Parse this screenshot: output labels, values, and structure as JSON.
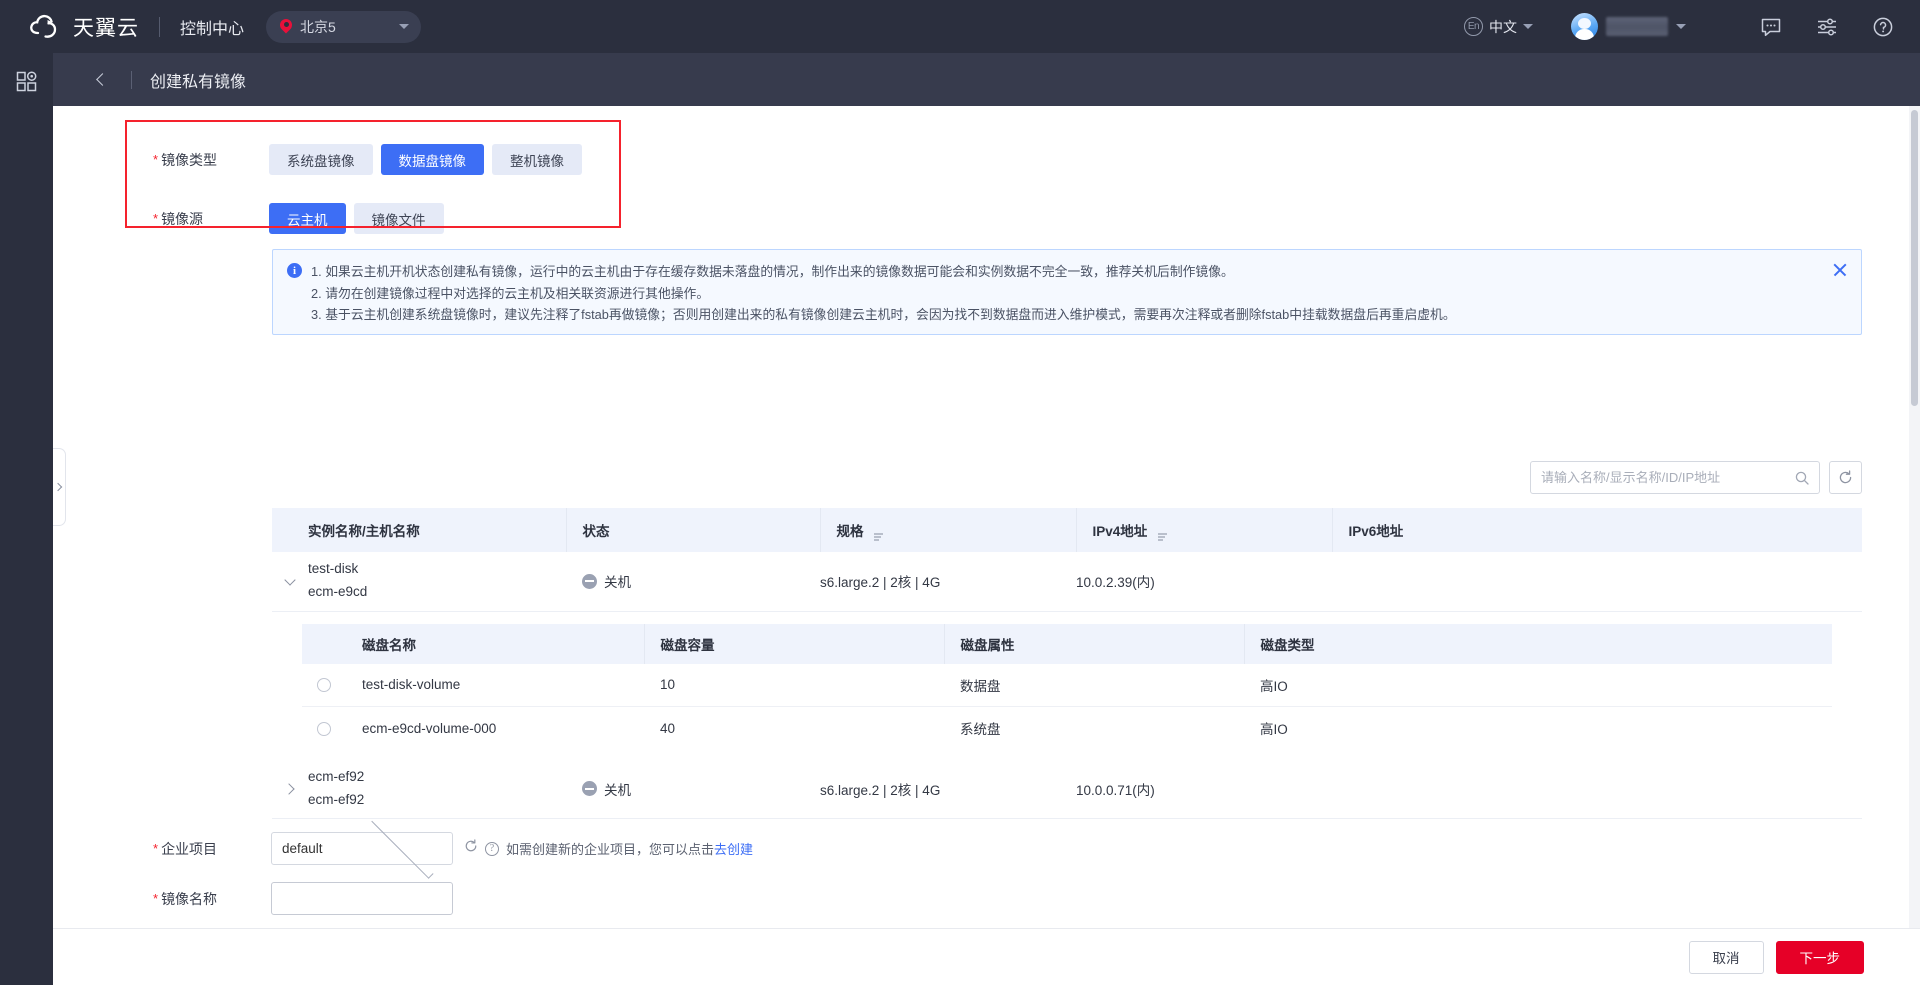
{
  "topbar": {
    "brand": "天翼云",
    "console_title": "控制中心",
    "region": "北京5",
    "lang_en": "En",
    "lang_label": "中文",
    "icons": {
      "pin": "location-pin-icon",
      "avatar": "avatar",
      "chat": "chat-icon",
      "settings": "sliders-icon",
      "help": "help-circle-icon"
    }
  },
  "subheader": {
    "title": "创建私有镜像",
    "back": "back-chevron-icon"
  },
  "form": {
    "image_type": {
      "label": "镜像类型",
      "required": true,
      "options": [
        "系统盘镜像",
        "数据盘镜像",
        "整机镜像"
      ],
      "selected": "数据盘镜像"
    },
    "image_source": {
      "label": "镜像源",
      "required": true,
      "options": [
        "云主机",
        "镜像文件"
      ],
      "selected": "云主机"
    },
    "enterprise_project": {
      "label": "企业项目",
      "required": true,
      "value": "default",
      "hint_prefix": "如需创建新的企业项目，您可以点击",
      "hint_link": "去创建"
    },
    "image_name": {
      "label": "镜像名称",
      "required": true,
      "value": "",
      "placeholder": ""
    }
  },
  "notice": {
    "lines": [
      "1. 如果云主机开机状态创建私有镜像，运行中的云主机由于存在缓存数据未落盘的情况，制作出来的镜像数据可能会和实例数据不完全一致，推荐关机后制作镜像。",
      "2. 请勿在创建镜像过程中对选择的云主机及相关联资源进行其他操作。",
      "3. 基于云主机创建系统盘镜像时，建议先注释了fstab再做镜像；否则用创建出来的私有镜像创建云主机时，会因为找不到数据盘而进入维护模式，需要再次注释或者删除fstab中挂载数据盘后再重启虚机。"
    ]
  },
  "search": {
    "placeholder": "请输入名称/显示名称/ID/IP地址",
    "value": ""
  },
  "instance_table": {
    "columns": [
      "实例名称/主机名称",
      "状态",
      "规格",
      "IPv4地址",
      "IPv6地址"
    ],
    "sortable": [
      "规格",
      "IPv4地址"
    ],
    "rows": [
      {
        "expanded": true,
        "name": "test-disk",
        "hostname": "ecm-e9cd",
        "status": "关机",
        "spec": "s6.large.2 | 2核 | 4G",
        "ipv4": "10.0.2.39(内)",
        "ipv6": ""
      },
      {
        "expanded": false,
        "name": "ecm-ef92",
        "hostname": "ecm-ef92",
        "status": "关机",
        "spec": "s6.large.2 | 2核 | 4G",
        "ipv4": "10.0.0.71(内)",
        "ipv6": ""
      }
    ]
  },
  "disk_table": {
    "columns": [
      "磁盘名称",
      "磁盘容量",
      "磁盘属性",
      "磁盘类型"
    ],
    "rows": [
      {
        "selected": false,
        "name": "test-disk-volume",
        "size": "10",
        "attribute": "数据盘",
        "type": "高IO"
      },
      {
        "selected": false,
        "name": "ecm-e9cd-volume-000",
        "size": "40",
        "attribute": "系统盘",
        "type": "高IO"
      }
    ]
  },
  "footer": {
    "cancel": "取消",
    "next": "下一步"
  },
  "colors": {
    "accent_blue": "#3d6ef5",
    "primary_red": "#e60027",
    "highlight_red": "#f5222d",
    "topbar_bg": "#2b2f3e",
    "subheader_bg": "#373b4d"
  }
}
